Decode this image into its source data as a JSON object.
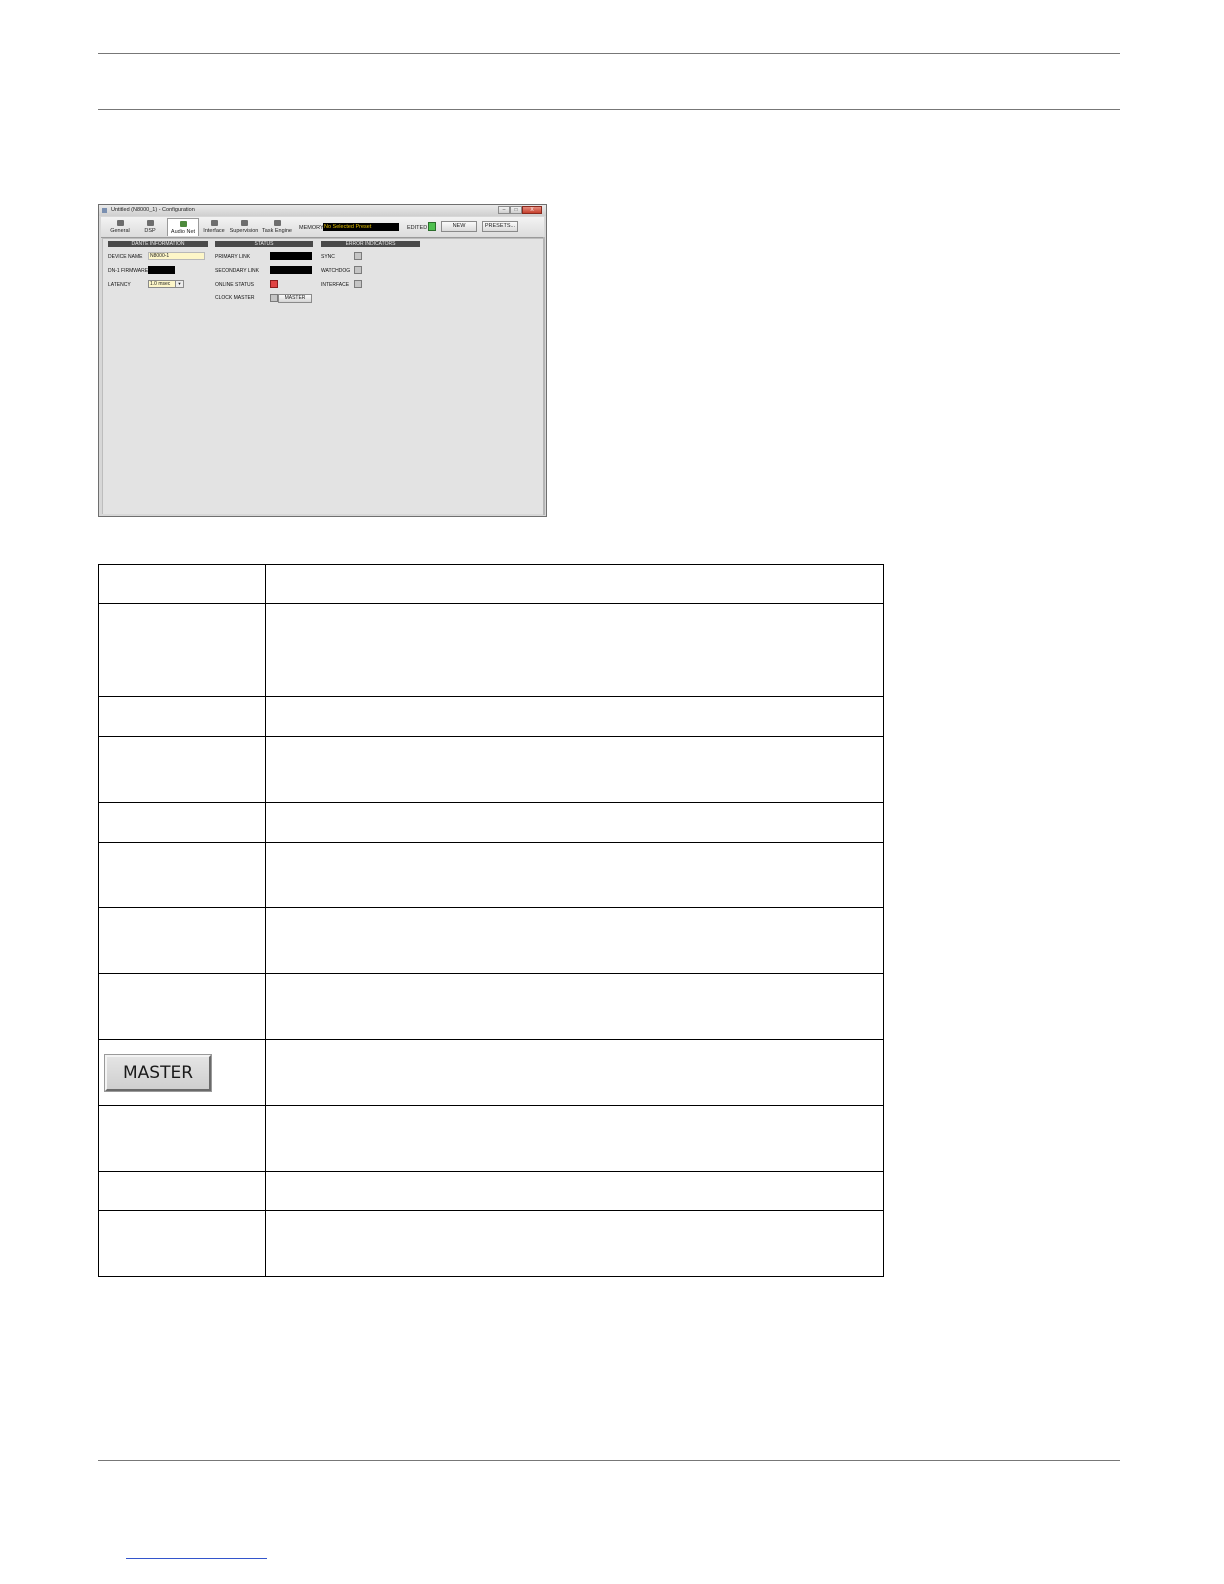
{
  "window": {
    "title": "Untitled (N8000_1) - Configuration",
    "controls": {
      "minimize": "–",
      "maximize": "□",
      "close": "X"
    }
  },
  "toolbar": {
    "tabs": [
      {
        "label": "General",
        "icon": "wrench-icon"
      },
      {
        "label": "DSP",
        "icon": "dsp-icon"
      },
      {
        "label": "Audio Net",
        "icon": "audio-net-icon",
        "active": true
      },
      {
        "label": "Interface",
        "icon": "interface-icon"
      },
      {
        "label": "Supervision",
        "icon": "supervision-icon"
      },
      {
        "label": "Task Engine",
        "icon": "task-engine-icon"
      }
    ],
    "memory_label": "MEMORY",
    "memory_value": "No Selected Preset",
    "edited_label": "EDITED",
    "new_label": "NEW",
    "presets_label": "PRESETS..."
  },
  "dante": {
    "header": "DANTE INFORMATION",
    "device_name_label": "DEVICE NAME",
    "device_name_value": "N8000-1",
    "firmware_label": "DN-1 FIRMWARE",
    "latency_label": "LATENCY",
    "latency_value": "1.0 msec"
  },
  "status": {
    "header": "STATUS",
    "primary_link_label": "PRIMARY LINK",
    "secondary_link_label": "SECONDARY LINK",
    "online_status_label": "ONLINE STATUS",
    "clock_master_label": "CLOCK MASTER",
    "master_button": "MASTER"
  },
  "errors": {
    "header": "ERROR INDICATORS",
    "sync_label": "SYNC",
    "watchdog_label": "WATCHDOG",
    "interface_label": "INTERFACE"
  },
  "table": {
    "rows": [
      {
        "c1": "",
        "c2": ""
      },
      {
        "c1": "",
        "c2": ""
      },
      {
        "c1": "",
        "c2": ""
      },
      {
        "c1": "",
        "c2": ""
      },
      {
        "c1": "",
        "c2": ""
      },
      {
        "c1": "",
        "c2": ""
      },
      {
        "c1": "",
        "c2": ""
      },
      {
        "c1": "",
        "c2": ""
      },
      {
        "c1": "MASTER",
        "c2": ""
      },
      {
        "c1": "",
        "c2": ""
      },
      {
        "c1": "",
        "c2": ""
      },
      {
        "c1": "",
        "c2": ""
      }
    ]
  },
  "colors": {
    "edited_led": "#4fc04f",
    "online_status_led": "#e04444",
    "memory_text": "#e6c200",
    "device_name_bg": "#fdf6c8"
  }
}
